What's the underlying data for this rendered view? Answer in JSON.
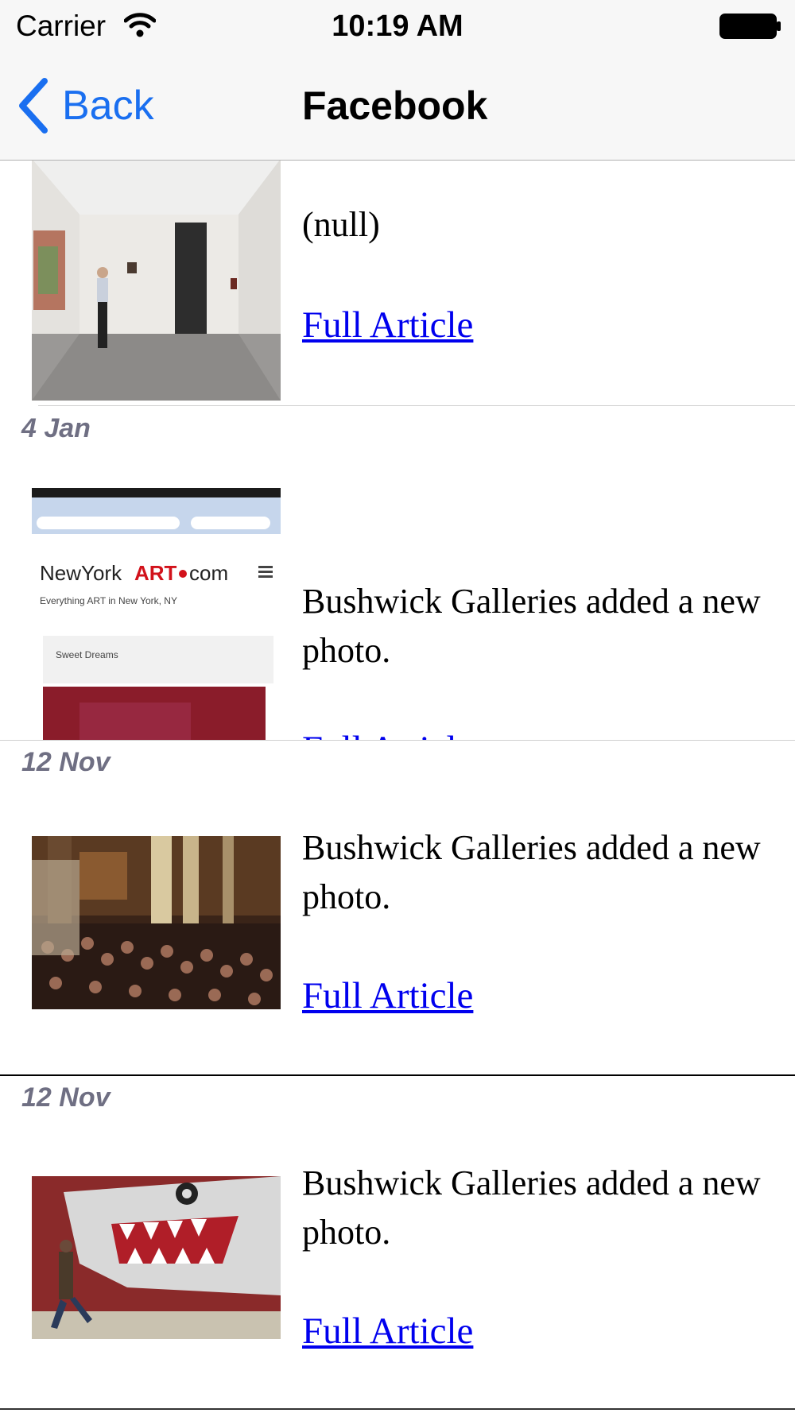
{
  "status_bar": {
    "carrier": "Carrier",
    "time": "10:19 AM"
  },
  "nav": {
    "back_label": "Back",
    "title": "Facebook"
  },
  "colors": {
    "link": "#0000ee",
    "nav_tint": "#1a6ff0",
    "section_header": "#6f6f83"
  },
  "feed": {
    "items": [
      {
        "text": "(null)",
        "link": "Full Article"
      },
      {
        "date": "4 Jan",
        "text": "Bushwick Galleries added a new photo.",
        "link": "Full Article",
        "thumb_texts": {
          "brand_black": "NewYork",
          "brand_red": "ART",
          "brand_suffix": "com",
          "tagline": "Everything ART in New York, NY",
          "card_title": "Sweet Dreams"
        }
      },
      {
        "date": "12 Nov",
        "text": "Bushwick Galleries added a new photo.",
        "link": "Full Article"
      },
      {
        "date": "12 Nov",
        "text": "Bushwick Galleries added a new photo.",
        "link": "Full Article"
      }
    ]
  }
}
